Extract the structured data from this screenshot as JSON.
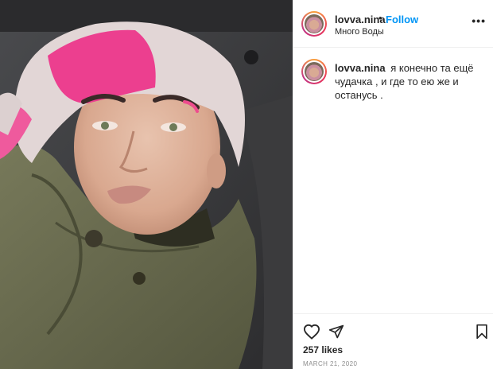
{
  "post": {
    "username": "lovva.nina",
    "separator": "•",
    "follow_label": "Follow",
    "location": "Много Воды",
    "more_label": "•••",
    "caption": "я конечно та ещё чудачка , и где то ею же и останусь .",
    "likes": "257 likes",
    "date": "MARCH 21, 2020"
  },
  "icons": {
    "like": "heart-outline-icon",
    "share": "paper-plane-icon",
    "save": "bookmark-icon",
    "more": "three-dots-icon"
  },
  "colors": {
    "link": "#0095f6",
    "text": "#262626",
    "muted": "#8e8e8e",
    "border": "#efefef"
  }
}
